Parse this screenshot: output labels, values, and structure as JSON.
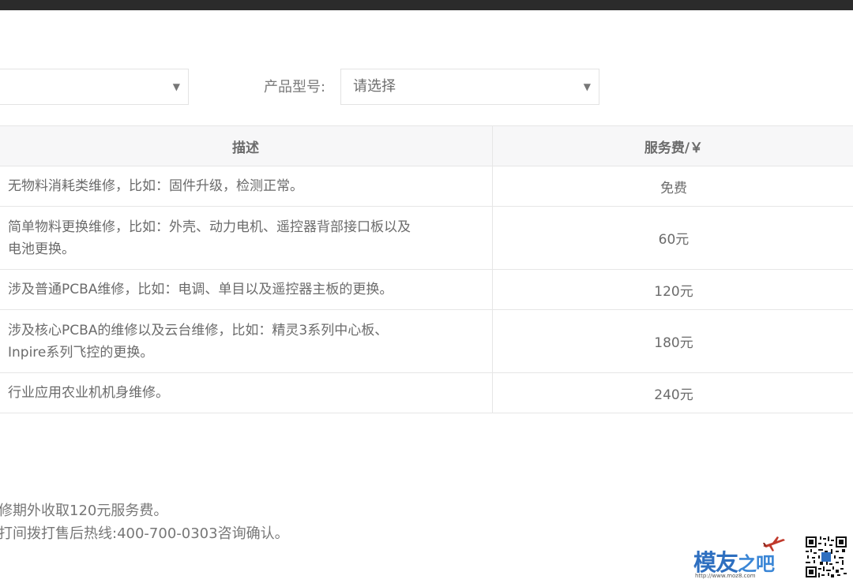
{
  "filters": {
    "left_select_value": "",
    "model_label": "产品型号:",
    "model_select_value": "请选择"
  },
  "table": {
    "headers": [
      "描述",
      "服务费/￥"
    ],
    "rows": [
      {
        "description_lines": [
          "无物料消耗类维修，比如：固件升级，检测正常。"
        ],
        "fee": "免费"
      },
      {
        "description_lines": [
          "简单物料更换维修，比如：外壳、动力电机、遥控器背部接口板以及",
          "电池更换。"
        ],
        "fee": "60元"
      },
      {
        "description_lines": [
          "涉及普通PCBA维修，比如：电调、单目以及遥控器主板的更换。"
        ],
        "fee": "120元"
      },
      {
        "description_lines": [
          "涉及核心PCBA的维修以及云台维修，比如：精灵3系列中心板、",
          "Inpire系列飞控的更换。"
        ],
        "fee": "180元"
      },
      {
        "description_lines": [
          "行业应用农业机机身维修。"
        ],
        "fee": "240元"
      }
    ]
  },
  "notes": [
    "修期外收取120元服务费。",
    "打间拨打售后热线:400-700-0303咨询确认。"
  ],
  "watermark": {
    "logo_main": "模友",
    "logo_small": "之吧",
    "url": "http://www.moz8.com",
    "brand_color": "#2e6fc0"
  }
}
